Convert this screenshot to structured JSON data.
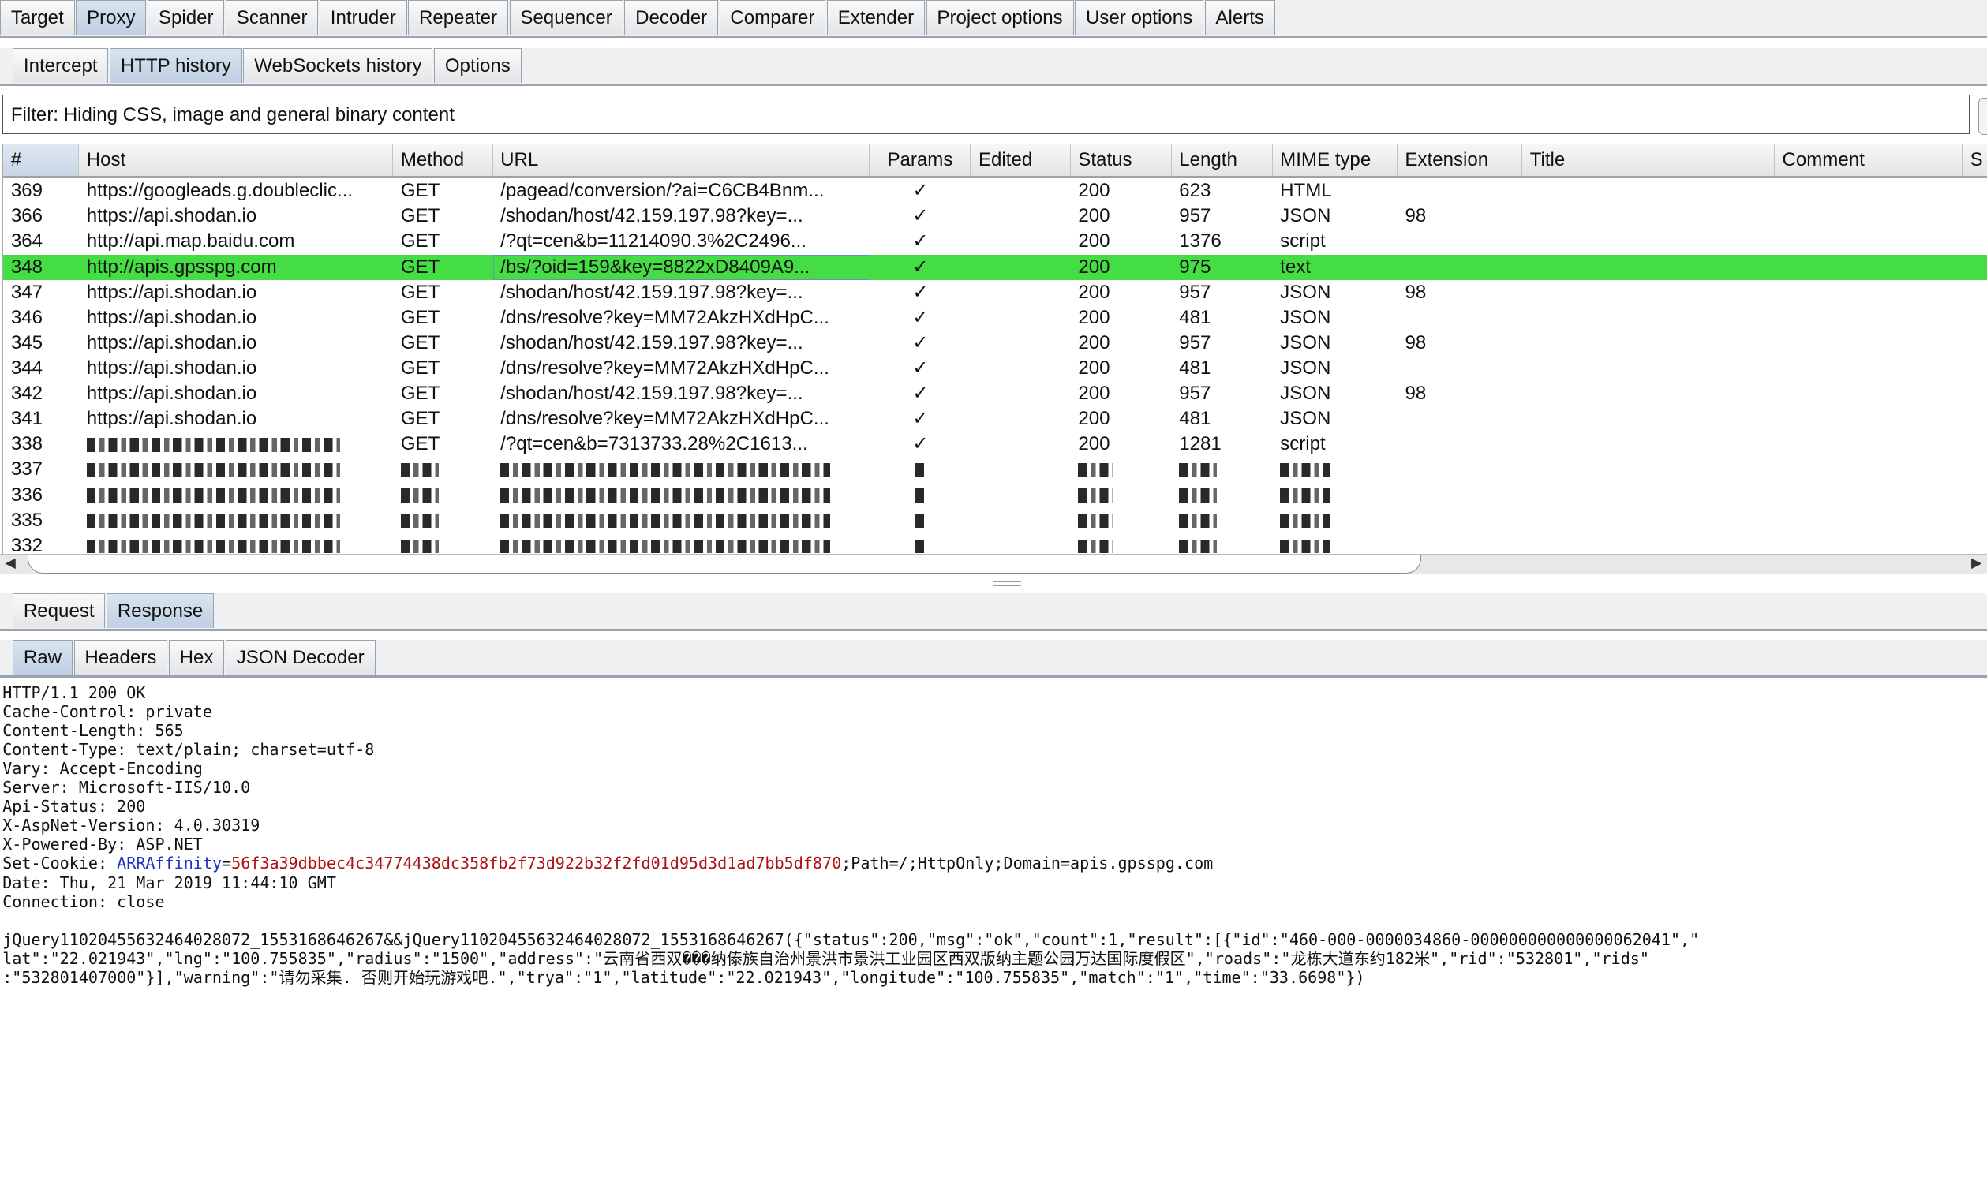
{
  "main_tabs": [
    "Target",
    "Proxy",
    "Spider",
    "Scanner",
    "Intruder",
    "Repeater",
    "Sequencer",
    "Decoder",
    "Comparer",
    "Extender",
    "Project options",
    "User options",
    "Alerts"
  ],
  "main_tab_selected": "Proxy",
  "proxy_tabs": [
    "Intercept",
    "HTTP history",
    "WebSockets history",
    "Options"
  ],
  "proxy_tab_selected": "HTTP history",
  "filter": "Filter: Hiding CSS, image and general binary content",
  "columns": [
    "#",
    "Host",
    "Method",
    "URL",
    "Params",
    "Edited",
    "Status",
    "Length",
    "MIME type",
    "Extension",
    "Title",
    "Comment",
    "S"
  ],
  "sort_icon": "triangle-down",
  "rows": [
    {
      "id": "369",
      "host": "https://googleads.g.doubleclic...",
      "method": "GET",
      "url": "/pagead/conversion/?ai=C6CB4Bnm...",
      "params": "✓",
      "status": "200",
      "length": "623",
      "mime": "HTML",
      "ext": ""
    },
    {
      "id": "366",
      "host": "https://api.shodan.io",
      "method": "GET",
      "url": "/shodan/host/42.159.197.98?key=...",
      "params": "✓",
      "status": "200",
      "length": "957",
      "mime": "JSON",
      "ext": "98"
    },
    {
      "id": "364",
      "host": "http://api.map.baidu.com",
      "method": "GET",
      "url": "/?qt=cen&b=11214090.3%2C2496...",
      "params": "✓",
      "status": "200",
      "length": "1376",
      "mime": "script",
      "ext": ""
    },
    {
      "id": "348",
      "host": "http://apis.gpsspg.com",
      "method": "GET",
      "url": "/bs/?oid=159&key=8822xD8409A9...",
      "params": "✓",
      "status": "200",
      "length": "975",
      "mime": "text",
      "ext": "",
      "selected": true
    },
    {
      "id": "347",
      "host": "https://api.shodan.io",
      "method": "GET",
      "url": "/shodan/host/42.159.197.98?key=...",
      "params": "✓",
      "status": "200",
      "length": "957",
      "mime": "JSON",
      "ext": "98"
    },
    {
      "id": "346",
      "host": "https://api.shodan.io",
      "method": "GET",
      "url": "/dns/resolve?key=MM72AkzHXdHpC...",
      "params": "✓",
      "status": "200",
      "length": "481",
      "mime": "JSON",
      "ext": ""
    },
    {
      "id": "345",
      "host": "https://api.shodan.io",
      "method": "GET",
      "url": "/shodan/host/42.159.197.98?key=...",
      "params": "✓",
      "status": "200",
      "length": "957",
      "mime": "JSON",
      "ext": "98"
    },
    {
      "id": "344",
      "host": "https://api.shodan.io",
      "method": "GET",
      "url": "/dns/resolve?key=MM72AkzHXdHpC...",
      "params": "✓",
      "status": "200",
      "length": "481",
      "mime": "JSON",
      "ext": ""
    },
    {
      "id": "342",
      "host": "https://api.shodan.io",
      "method": "GET",
      "url": "/shodan/host/42.159.197.98?key=...",
      "params": "✓",
      "status": "200",
      "length": "957",
      "mime": "JSON",
      "ext": "98"
    },
    {
      "id": "341",
      "host": "https://api.shodan.io",
      "method": "GET",
      "url": "/dns/resolve?key=MM72AkzHXdHpC...",
      "params": "✓",
      "status": "200",
      "length": "481",
      "mime": "JSON",
      "ext": ""
    },
    {
      "id": "338",
      "host": "",
      "method": "GET",
      "url": "/?qt=cen&b=7313733.28%2C1613...",
      "params": "✓",
      "status": "200",
      "length": "1281",
      "mime": "script",
      "ext": ""
    },
    {
      "id": "337",
      "redacted": true
    },
    {
      "id": "336",
      "redacted": true
    },
    {
      "id": "335",
      "redacted": true
    },
    {
      "id": "332",
      "redacted": true
    }
  ],
  "message_tabs": [
    "Request",
    "Response"
  ],
  "message_tab_selected": "Response",
  "view_tabs": [
    "Raw",
    "Headers",
    "Hex",
    "JSON Decoder"
  ],
  "view_tab_selected": "Raw",
  "response": {
    "headers_before": [
      "HTTP/1.1 200 OK",
      "Cache-Control: private",
      "Content-Length: 565",
      "Content-Type: text/plain; charset=utf-8",
      "Vary: Accept-Encoding",
      "Server: Microsoft-IIS/10.0",
      "Api-Status: 200",
      "X-AspNet-Version: 4.0.30319",
      "X-Powered-By: ASP.NET"
    ],
    "cookie_prefix": "Set-Cookie: ",
    "cookie_name": "ARRAffinity",
    "cookie_eq": "=",
    "cookie_value": "56f3a39dbbec4c34774438dc358fb2f73d922b32f2fd01d95d3d1ad7bb5df870",
    "cookie_rest": ";Path=/;HttpOnly;Domain=apis.gpsspg.com",
    "headers_after": [
      "Date: Thu, 21 Mar 2019 11:44:10 GMT",
      "Connection: close"
    ],
    "body_lines": [
      "jQuery110204556324640280​72_1553168646267&&jQuery11020455632464028072_1553168646267({\"status\":200,\"msg\":\"ok\",\"count\":1,\"result\":[{\"id\":\"460-000-0000034860-000000000000000062041\",\"",
      "lat\":\"22.021943\",\"lng\":\"100.755835\",\"radius\":\"1500\",\"address\":\"云南省西双���纳傣族自治州景洪市景洪工业园区西双版纳主题公园万达国际度假区\",\"roads\":\"龙栋大道东约182米\",\"rid\":\"532801\",\"rids\"",
      ":\"532801407000\"}],\"warning\":\"请勿采集. 否则开始玩游戏吧.\",\"trya\":\"1\",\"latitude\":\"22.021943\",\"longitude\":\"100.755835\",\"match\":\"1\",\"time\":\"33.6698\"})"
    ]
  },
  "colors": {
    "selected_row": "#44dd44",
    "cookie_name": "#1a32c8",
    "cookie_value": "#b01010"
  }
}
